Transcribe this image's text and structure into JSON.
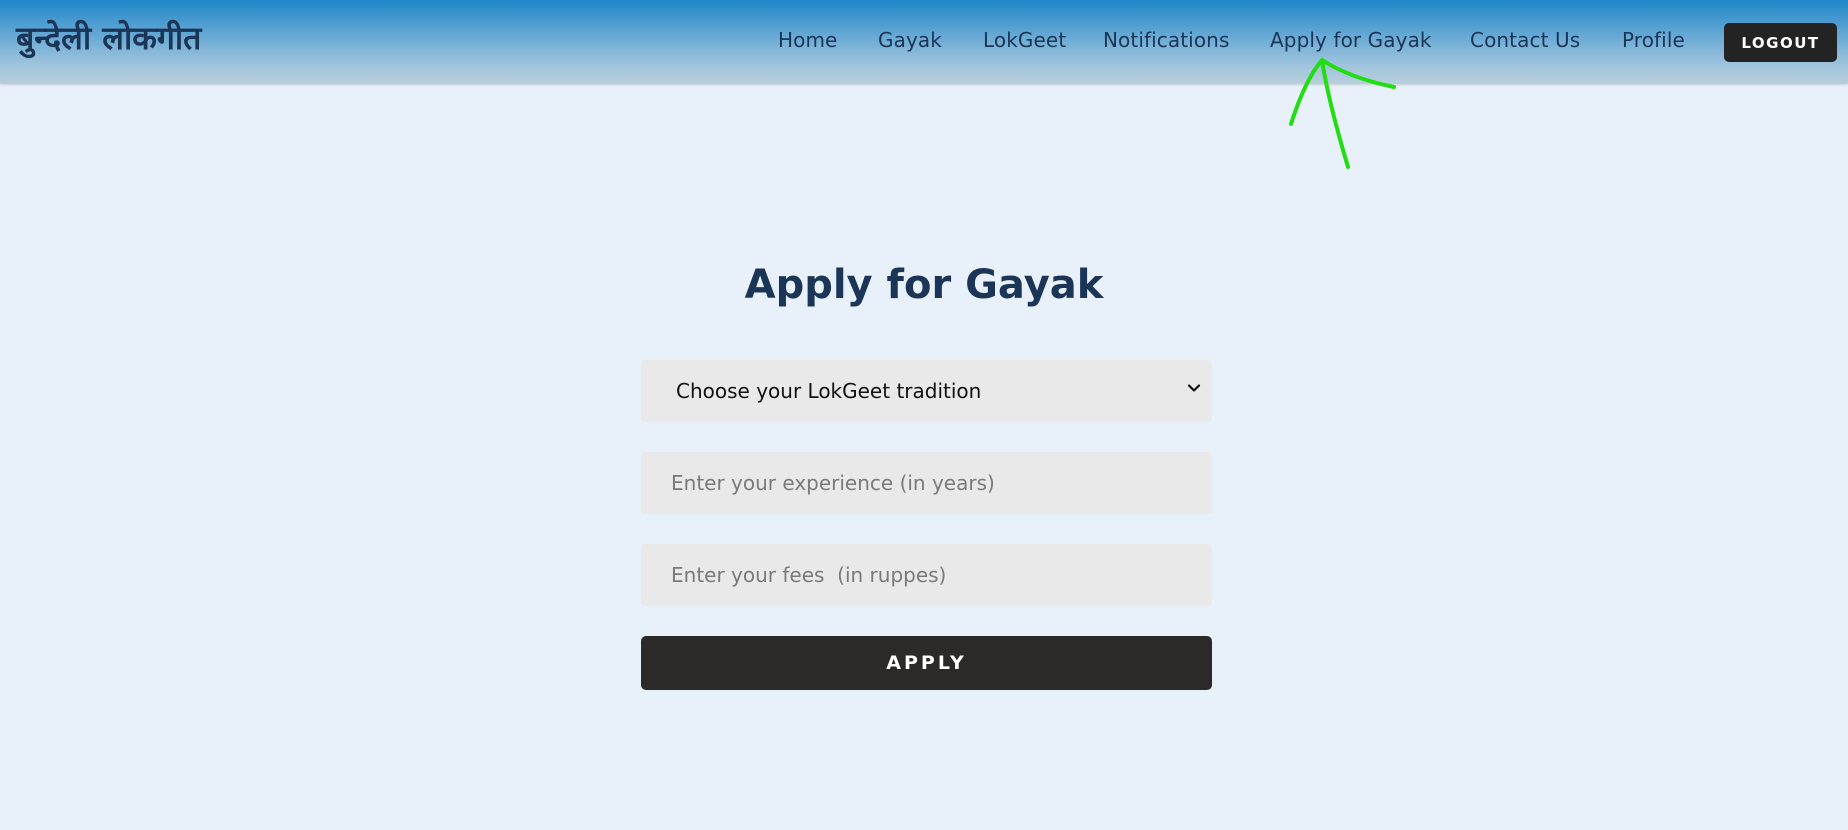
{
  "header": {
    "brand": "बुन्देली लोकगीत",
    "nav": [
      {
        "label": "Home"
      },
      {
        "label": "Gayak"
      },
      {
        "label": "LokGeet"
      },
      {
        "label": "Notifications"
      },
      {
        "label": "Apply for Gayak"
      },
      {
        "label": "Contact Us"
      },
      {
        "label": "Profile"
      }
    ],
    "logout_label": "LOGOUT"
  },
  "form": {
    "title": "Apply for Gayak",
    "tradition_select": {
      "selected": "Choose your LokGeet tradition",
      "icon": "chevron-down-icon"
    },
    "experience_placeholder": "Enter your experience (in years)",
    "fees_placeholder": "Enter your fees  (in ruppes)",
    "apply_label": "APPLY"
  },
  "annotation": {
    "icon": "green-arrow-annotation-icon",
    "color": "#22dd11"
  },
  "colors": {
    "page_background": "#e8f0fa",
    "header_gradient_top": "#1f86c8",
    "header_gradient_bottom": "#b8cfdc",
    "text_primary": "#1b3556",
    "button_dark": "#2b2a28",
    "field_background": "#e9e9e9"
  }
}
